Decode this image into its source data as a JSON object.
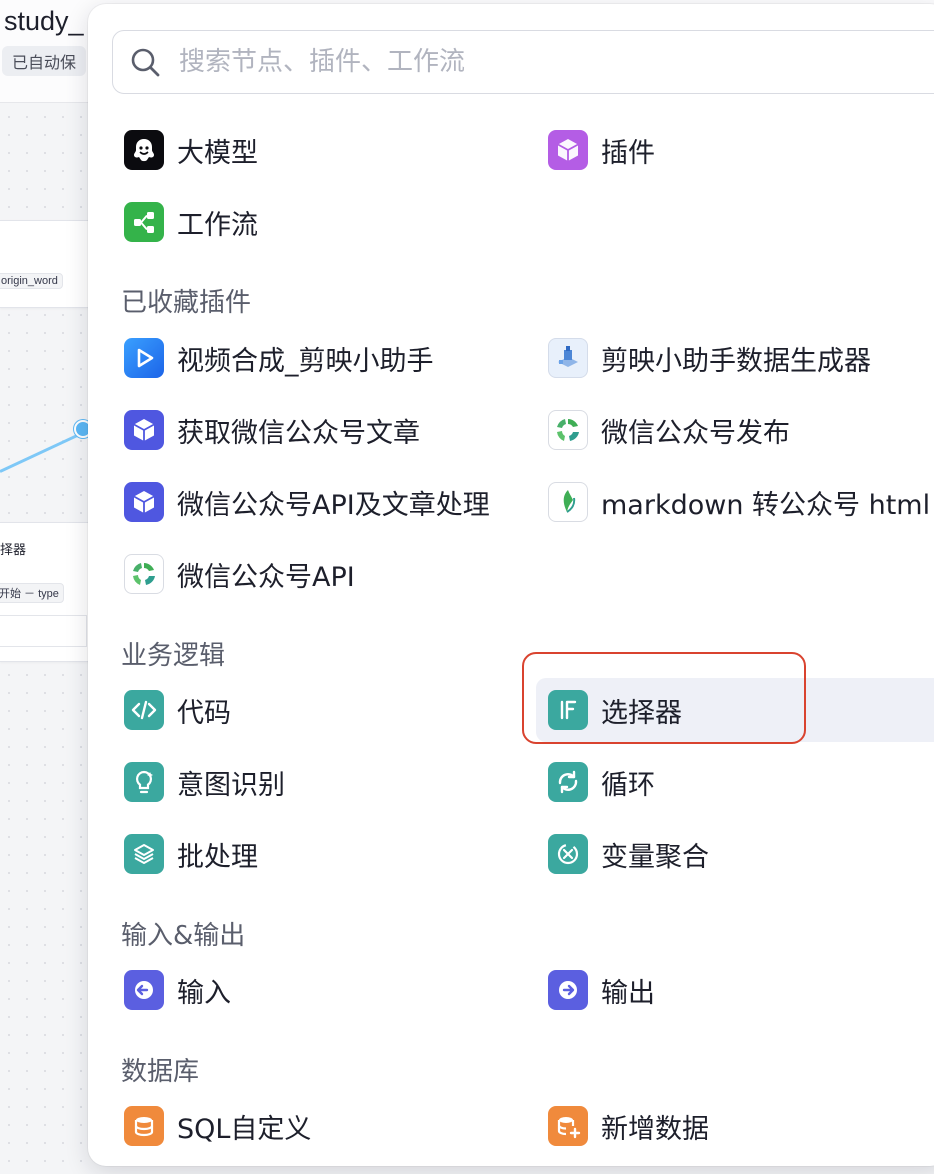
{
  "app": {
    "title": "study_",
    "autosave": "已自动保"
  },
  "nodes": {
    "tag_origin": "origin_word",
    "selector_name": "择器",
    "selector_tag": "开始 － type"
  },
  "search": {
    "placeholder": "搜索节点、插件、工作流"
  },
  "top_items": [
    {
      "label": "大模型",
      "icon": "llm-icon",
      "color": "#0b0b0f"
    },
    {
      "label": "插件",
      "icon": "plugin-cube-icon",
      "color": "#b45de5"
    },
    {
      "label": "工作流",
      "icon": "workflow-icon",
      "color": "#34b34a"
    }
  ],
  "sections": {
    "favorites": {
      "title": "已收藏插件",
      "items": [
        {
          "label": "视频合成_剪映小助手",
          "icon": "video-play-icon"
        },
        {
          "label": "剪映小助手数据生成器",
          "icon": "data-generator-icon"
        },
        {
          "label": "获取微信公众号文章",
          "icon": "cube-icon"
        },
        {
          "label": "微信公众号发布",
          "icon": "wechat-swirl-icon"
        },
        {
          "label": "微信公众号API及文章处理",
          "icon": "cube-icon"
        },
        {
          "label": "markdown 转公众号 html",
          "icon": "wechat-leaf-icon"
        },
        {
          "label": "微信公众号API",
          "icon": "wechat-swirl-icon"
        }
      ]
    },
    "logic": {
      "title": "业务逻辑",
      "items": [
        {
          "label": "代码",
          "icon": "code-icon"
        },
        {
          "label": "选择器",
          "icon": "if-icon"
        },
        {
          "label": "意图识别",
          "icon": "intent-bulb-icon"
        },
        {
          "label": "循环",
          "icon": "loop-icon"
        },
        {
          "label": "批处理",
          "icon": "layers-icon"
        },
        {
          "label": "变量聚合",
          "icon": "variable-merge-icon"
        }
      ]
    },
    "io": {
      "title": "输入&输出",
      "items": [
        {
          "label": "输入",
          "icon": "input-arrow-icon"
        },
        {
          "label": "输出",
          "icon": "output-arrow-icon"
        }
      ]
    },
    "database": {
      "title": "数据库",
      "items": [
        {
          "label": "SQL自定义",
          "icon": "database-icon"
        },
        {
          "label": "新增数据",
          "icon": "database-add-icon"
        }
      ]
    }
  },
  "colors": {
    "teal": "#3ba89f",
    "indigo": "#5b5fe0",
    "highlight_ring": "#d9432f",
    "highlight_bg": "#eef0f7"
  }
}
